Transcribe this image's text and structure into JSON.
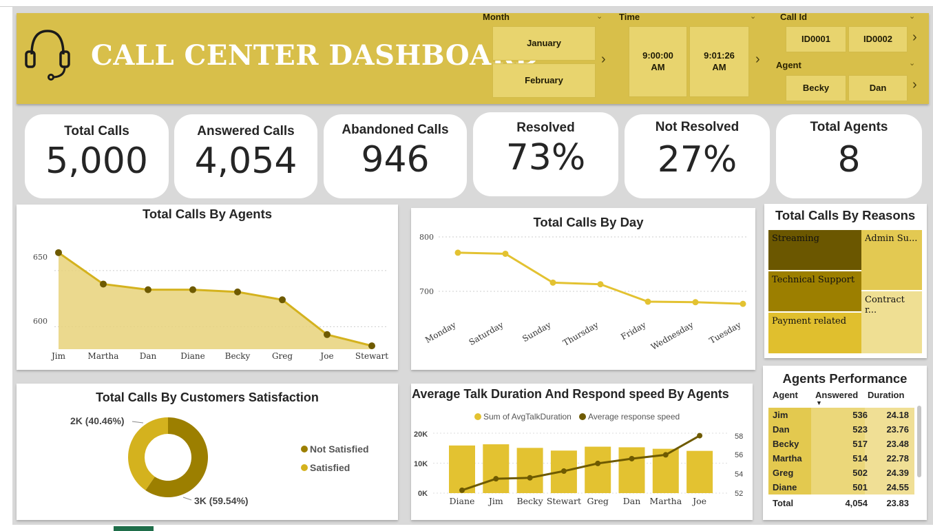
{
  "header": {
    "title": "CALL CENTER DASHBOARD",
    "slicers": {
      "month": {
        "label": "Month",
        "items": [
          "January",
          "February"
        ]
      },
      "time": {
        "label": "Time",
        "items": [
          "9:00:00\nAM",
          "9:01:26\nAM"
        ]
      },
      "call_id": {
        "label": "Call Id",
        "items": [
          "ID0001",
          "ID0002"
        ]
      },
      "agent": {
        "label": "Agent",
        "items": [
          "Becky",
          "Dan"
        ]
      }
    }
  },
  "kpis": [
    {
      "label": "Total Calls",
      "value": "5,000"
    },
    {
      "label": "Answered Calls",
      "value": "4,054"
    },
    {
      "label": "Abandoned Calls",
      "value": "946"
    },
    {
      "label": "Resolved",
      "value": "73%"
    },
    {
      "label": "Not Resolved",
      "value": "27%"
    },
    {
      "label": "Total Agents",
      "value": "8"
    }
  ],
  "agents_chart": {
    "title": "Total Calls By Agents",
    "ticks": [
      "650",
      "600"
    ]
  },
  "day_chart": {
    "title": "Total Calls By Day",
    "ticks": [
      "800",
      "700"
    ]
  },
  "reasons": {
    "title": "Total Calls By Reasons",
    "tiles": [
      "Streaming",
      "Admin Su...",
      "Technical Support",
      "Contract r...",
      "Payment related"
    ]
  },
  "satisfaction": {
    "title": "Total Calls By Customers Satisfaction",
    "label_sat": "2K (40.46%)",
    "label_not": "3K (59.54%)",
    "legend": [
      "Not Satisfied",
      "Satisfied"
    ]
  },
  "talk_chart": {
    "title": "Average Talk Duration And Respond speed By Agents",
    "legend": [
      "Sum of AvgTalkDuration",
      "Average response speed"
    ],
    "left_ticks": [
      "20K",
      "10K",
      "0K"
    ],
    "right_ticks": [
      "58",
      "56",
      "54",
      "52"
    ]
  },
  "performance": {
    "title": "Agents Performance",
    "headers": [
      "Agent",
      "Answered",
      "Duration"
    ],
    "rows": [
      {
        "agent": "Jim",
        "answered": "536",
        "duration": "24.18"
      },
      {
        "agent": "Dan",
        "answered": "523",
        "duration": "23.76"
      },
      {
        "agent": "Becky",
        "answered": "517",
        "duration": "23.48"
      },
      {
        "agent": "Martha",
        "answered": "514",
        "duration": "22.78"
      },
      {
        "agent": "Greg",
        "answered": "502",
        "duration": "24.39"
      },
      {
        "agent": "Diane",
        "answered": "501",
        "duration": "24.55"
      }
    ],
    "total": {
      "agent": "Total",
      "answered": "4,054",
      "duration": "23.83"
    }
  },
  "colors": {
    "gold": "#d4b21e",
    "gold_light": "#e8d27a",
    "dark_olive": "#6e5a00",
    "header_bg": "#d8bf4a"
  },
  "chart_data": [
    {
      "type": "area",
      "title": "Total Calls By Agents",
      "categories": [
        "Jim",
        "Martha",
        "Dan",
        "Diane",
        "Becky",
        "Greg",
        "Joe",
        "Stewart"
      ],
      "values": [
        666,
        638,
        633,
        633,
        631,
        624,
        593,
        583
      ],
      "ylim": [
        580,
        680
      ],
      "grid": true
    },
    {
      "type": "line",
      "title": "Total Calls By Day",
      "categories": [
        "Monday",
        "Saturday",
        "Sunday",
        "Thursday",
        "Friday",
        "Wednesday",
        "Tuesday"
      ],
      "values": [
        771,
        769,
        716,
        713,
        681,
        680,
        677
      ],
      "ylim": [
        650,
        810
      ],
      "grid": true
    },
    {
      "type": "pie",
      "title": "Total Calls By Customers Satisfaction",
      "categories": [
        "Not Satisfied",
        "Satisfied"
      ],
      "values": [
        59.54,
        40.46
      ]
    },
    {
      "type": "bar",
      "title": "Average Talk Duration And Respond speed By Agents",
      "categories": [
        "Diane",
        "Jim",
        "Becky",
        "Stewart",
        "Greg",
        "Dan",
        "Martha",
        "Joe"
      ],
      "series": [
        {
          "name": "Sum of AvgTalkDuration",
          "type": "bar",
          "values": [
            15900,
            16300,
            15100,
            14200,
            15500,
            15300,
            14800,
            14100
          ]
        },
        {
          "name": "Average response speed",
          "type": "line",
          "axis": "right",
          "values": [
            52.3,
            53.5,
            53.6,
            54.3,
            55.1,
            55.6,
            56.0,
            58.0
          ]
        }
      ],
      "ylim": [
        0,
        22000
      ],
      "y2lim": [
        51.5,
        58.5
      ]
    },
    {
      "type": "treemap",
      "title": "Total Calls By Reasons",
      "categories": [
        "Streaming",
        "Technical Support",
        "Payment related",
        "Admin Su...",
        "Contract r..."
      ]
    }
  ]
}
